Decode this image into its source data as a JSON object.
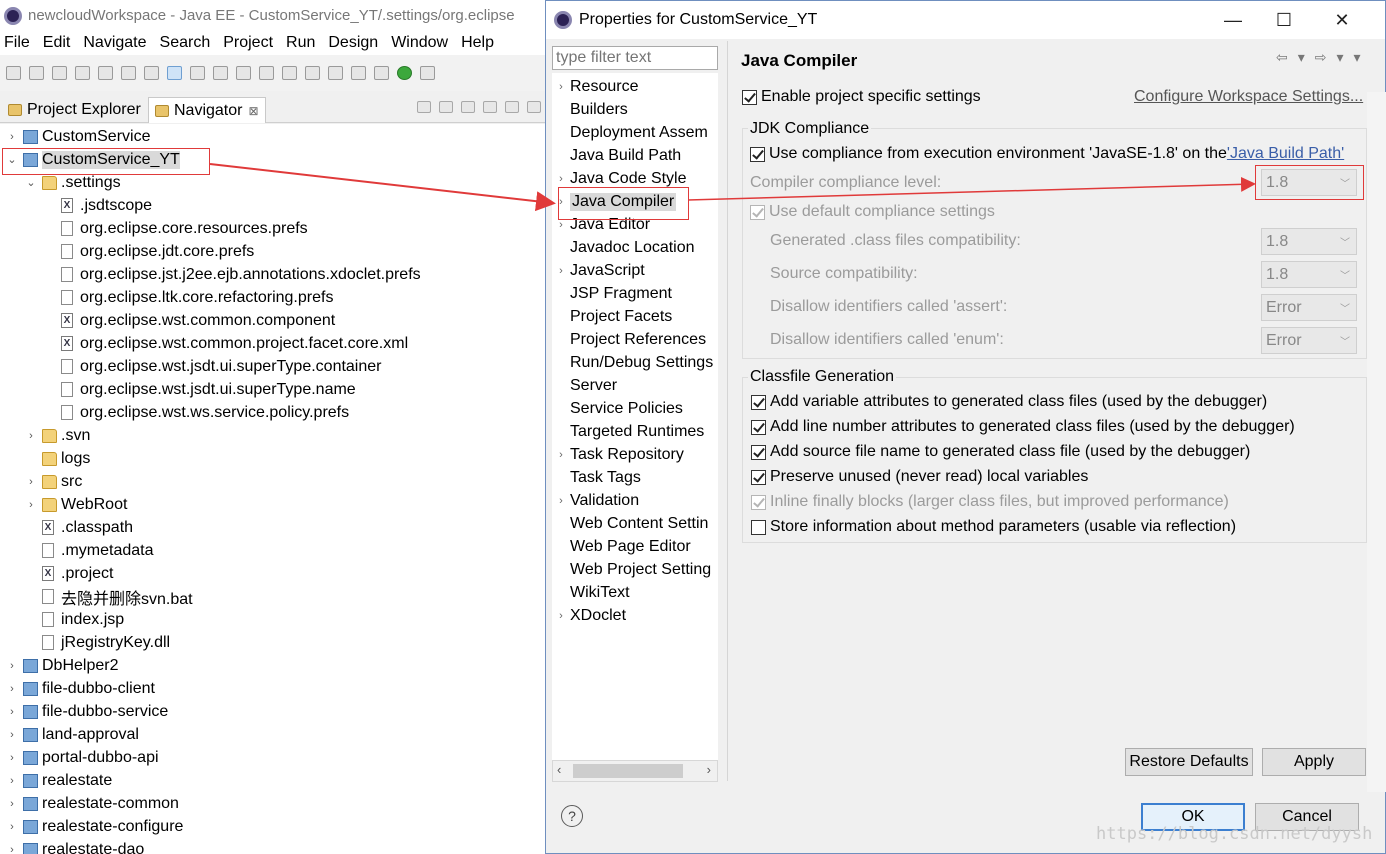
{
  "eclipse": {
    "title": "newcloudWorkspace - Java EE - CustomService_YT/.settings/org.eclipse",
    "menu": [
      "File",
      "Edit",
      "Navigate",
      "Search",
      "Project",
      "Run",
      "Design",
      "Window",
      "Help"
    ],
    "tabs": [
      "Project Explorer",
      "Navigator"
    ],
    "tab_close": "⊠",
    "tree": [
      {
        "label": "CustomService",
        "icon": "project",
        "level": 0,
        "twisty": "›"
      },
      {
        "label": "CustomService_YT",
        "icon": "project",
        "level": 0,
        "twisty": "⌄",
        "selected": true
      },
      {
        "label": ".settings",
        "icon": "folder",
        "level": 1,
        "twisty": "⌄"
      },
      {
        "label": ".jsdtscope",
        "icon": "xml",
        "level": 2,
        "twisty": ""
      },
      {
        "label": "org.eclipse.core.resources.prefs",
        "icon": "file",
        "level": 2,
        "twisty": ""
      },
      {
        "label": "org.eclipse.jdt.core.prefs",
        "icon": "file",
        "level": 2,
        "twisty": ""
      },
      {
        "label": "org.eclipse.jst.j2ee.ejb.annotations.xdoclet.prefs",
        "icon": "file",
        "level": 2,
        "twisty": ""
      },
      {
        "label": "org.eclipse.ltk.core.refactoring.prefs",
        "icon": "file",
        "level": 2,
        "twisty": ""
      },
      {
        "label": "org.eclipse.wst.common.component",
        "icon": "xml",
        "level": 2,
        "twisty": ""
      },
      {
        "label": "org.eclipse.wst.common.project.facet.core.xml",
        "icon": "xml",
        "level": 2,
        "twisty": ""
      },
      {
        "label": "org.eclipse.wst.jsdt.ui.superType.container",
        "icon": "file",
        "level": 2,
        "twisty": ""
      },
      {
        "label": "org.eclipse.wst.jsdt.ui.superType.name",
        "icon": "file",
        "level": 2,
        "twisty": ""
      },
      {
        "label": "org.eclipse.wst.ws.service.policy.prefs",
        "icon": "file",
        "level": 2,
        "twisty": ""
      },
      {
        "label": ".svn",
        "icon": "folder",
        "level": 1,
        "twisty": "›"
      },
      {
        "label": "logs",
        "icon": "folder",
        "level": 1,
        "twisty": ""
      },
      {
        "label": "src",
        "icon": "folder",
        "level": 1,
        "twisty": "›"
      },
      {
        "label": "WebRoot",
        "icon": "folder",
        "level": 1,
        "twisty": "›"
      },
      {
        "label": ".classpath",
        "icon": "xml",
        "level": 1,
        "twisty": ""
      },
      {
        "label": ".mymetadata",
        "icon": "file",
        "level": 1,
        "twisty": ""
      },
      {
        "label": ".project",
        "icon": "xml",
        "level": 1,
        "twisty": ""
      },
      {
        "label": "去隐并删除svn.bat",
        "icon": "file",
        "level": 1,
        "twisty": ""
      },
      {
        "label": "index.jsp",
        "icon": "file",
        "level": 1,
        "twisty": ""
      },
      {
        "label": "jRegistryKey.dll",
        "icon": "file",
        "level": 1,
        "twisty": ""
      },
      {
        "label": "DbHelper2",
        "icon": "project",
        "level": 0,
        "twisty": "›"
      },
      {
        "label": "file-dubbo-client",
        "icon": "project",
        "level": 0,
        "twisty": "›"
      },
      {
        "label": "file-dubbo-service",
        "icon": "project",
        "level": 0,
        "twisty": "›"
      },
      {
        "label": "land-approval",
        "icon": "project",
        "level": 0,
        "twisty": "›"
      },
      {
        "label": "portal-dubbo-api",
        "icon": "project",
        "level": 0,
        "twisty": "›"
      },
      {
        "label": "realestate",
        "icon": "project",
        "level": 0,
        "twisty": "›"
      },
      {
        "label": "realestate-common",
        "icon": "project",
        "level": 0,
        "twisty": "›"
      },
      {
        "label": "realestate-configure",
        "icon": "project",
        "level": 0,
        "twisty": "›"
      },
      {
        "label": "realestate-dao",
        "icon": "project",
        "level": 0,
        "twisty": "›"
      }
    ]
  },
  "dialog": {
    "title": "Properties for CustomService_YT",
    "window_buttons": {
      "minimize": "—",
      "maximize": "☐",
      "close": "✕"
    },
    "filter_placeholder": "type filter text",
    "nav": [
      {
        "label": "Resource",
        "twisty": "›"
      },
      {
        "label": "Builders",
        "twisty": ""
      },
      {
        "label": "Deployment Assem",
        "twisty": ""
      },
      {
        "label": "Java Build Path",
        "twisty": ""
      },
      {
        "label": "Java Code Style",
        "twisty": "›"
      },
      {
        "label": "Java Compiler",
        "twisty": "›",
        "selected": true
      },
      {
        "label": "Java Editor",
        "twisty": "›"
      },
      {
        "label": "Javadoc Location",
        "twisty": ""
      },
      {
        "label": "JavaScript",
        "twisty": "›"
      },
      {
        "label": "JSP Fragment",
        "twisty": ""
      },
      {
        "label": "Project Facets",
        "twisty": ""
      },
      {
        "label": "Project References",
        "twisty": ""
      },
      {
        "label": "Run/Debug Settings",
        "twisty": ""
      },
      {
        "label": "Server",
        "twisty": ""
      },
      {
        "label": "Service Policies",
        "twisty": ""
      },
      {
        "label": "Targeted Runtimes",
        "twisty": ""
      },
      {
        "label": "Task Repository",
        "twisty": "›"
      },
      {
        "label": "Task Tags",
        "twisty": ""
      },
      {
        "label": "Validation",
        "twisty": "›"
      },
      {
        "label": "Web Content Settin",
        "twisty": ""
      },
      {
        "label": "Web Page Editor",
        "twisty": ""
      },
      {
        "label": "Web Project Setting",
        "twisty": ""
      },
      {
        "label": "WikiText",
        "twisty": ""
      },
      {
        "label": "XDoclet",
        "twisty": "›"
      }
    ],
    "page_title": "Java Compiler",
    "nav_arrows": [
      "⇦",
      "▾",
      "⇨",
      "▾",
      "▾"
    ],
    "enable_specific": {
      "label": "Enable project specific settings",
      "checked": true
    },
    "configure_link": "Configure Workspace Settings...",
    "jdk": {
      "group_label": "JDK Compliance",
      "use_compliance_prefix": "Use compliance from execution environment 'JavaSE-1.8' on the ",
      "use_compliance_link": "'Java Build Path'",
      "compliance_level_label": "Compiler compliance level:",
      "compliance_level_value": "1.8",
      "use_default_label": "Use default compliance settings",
      "generated_label": "Generated .class files compatibility:",
      "generated_value": "1.8",
      "source_label": "Source compatibility:",
      "source_value": "1.8",
      "assert_label": "Disallow identifiers called 'assert':",
      "assert_value": "Error",
      "enum_label": "Disallow identifiers called 'enum':",
      "enum_value": "Error"
    },
    "classfile": {
      "group_label": "Classfile Generation",
      "options": [
        {
          "label": "Add variable attributes to generated class files (used by the debugger)",
          "checked": true,
          "disabled": false
        },
        {
          "label": "Add line number attributes to generated class files (used by the debugger)",
          "checked": true,
          "disabled": false
        },
        {
          "label": "Add source file name to generated class file (used by the debugger)",
          "checked": true,
          "disabled": false
        },
        {
          "label": "Preserve unused (never read) local variables",
          "checked": true,
          "disabled": false
        },
        {
          "label": "Inline finally blocks (larger class files, but improved performance)",
          "checked": true,
          "disabled": true
        },
        {
          "label": "Store information about method parameters (usable via reflection)",
          "checked": false,
          "disabled": false
        }
      ]
    },
    "buttons": {
      "restore": "Restore Defaults",
      "apply": "Apply",
      "ok": "OK",
      "cancel": "Cancel"
    },
    "help": "?"
  },
  "watermark": "https://blog.csdn.net/dyysh",
  "colors": {
    "annotation": "#e03a3a",
    "link": "#3a5ea8",
    "default_button_border": "#3c7fd0"
  }
}
